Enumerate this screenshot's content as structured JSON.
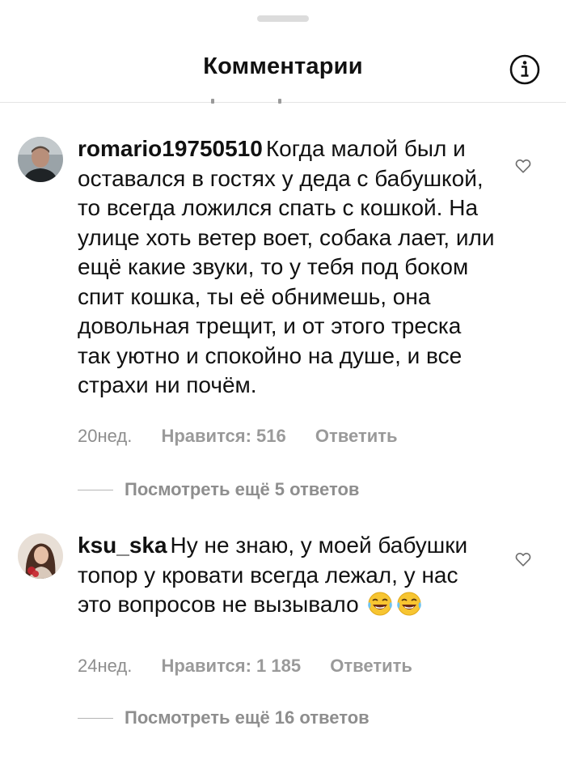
{
  "header": {
    "title": "Комментарии",
    "info_icon": "info-circle-icon"
  },
  "comments": [
    {
      "username": "romario19750510",
      "text": "Когда малой был и оставался в гостях у деда с бабушкой, то всегда ложился спать с кошкой. На улице хоть ветер воет, собака лает, или ещё какие звуки, то у тебя под боком спит кошка, ты её обнимешь, она довольная трещит, и от этого треска так уютно и спокойно на душе, и все страхи ни почём.",
      "time": "20нед.",
      "likes": "Нравится: 516",
      "reply": "Ответить",
      "view_replies": "Посмотреть ещё 5 ответов",
      "like_icon": "heart-outline-icon"
    },
    {
      "username": "ksu_ska",
      "text": "Ну не знаю, у моей бабушки топор у кровати всегда лежал, у нас это вопросов не вызывало",
      "emojis": [
        "rolling-on-floor-laughing-icon",
        "rolling-on-floor-laughing-icon"
      ],
      "time": "24нед.",
      "likes": "Нравится: 1 185",
      "reply": "Ответить",
      "view_replies": "Посмотреть ещё 16 ответов",
      "like_icon": "heart-outline-icon"
    }
  ]
}
